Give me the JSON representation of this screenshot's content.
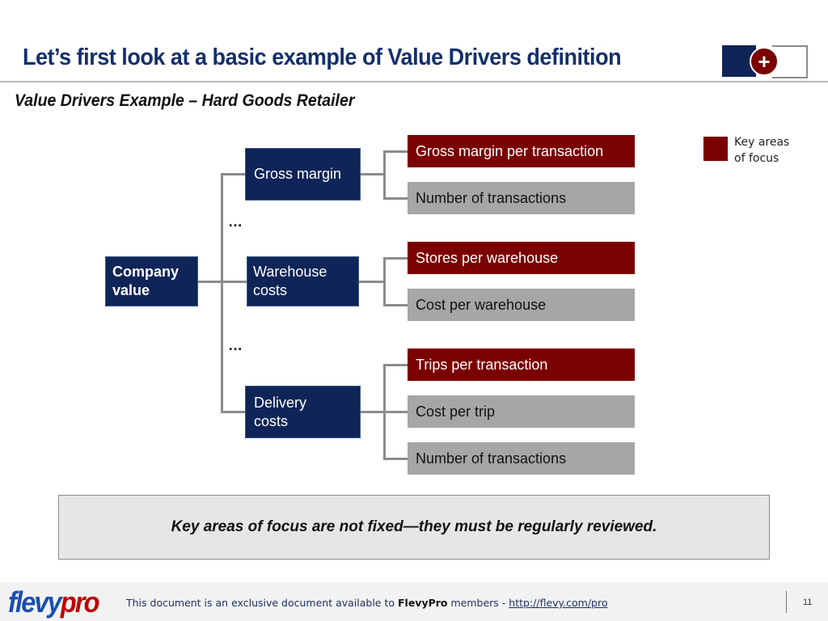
{
  "header": {
    "title": "Let’s first look at a basic example of Value Drivers definition",
    "subtitle": "Value Drivers Example – Hard Goods Retailer",
    "logo_icon": "plus-icon",
    "logo_symbol": "+"
  },
  "legend": {
    "label_line1": "Key areas",
    "label_line2": "of focus",
    "color": "#7b0000"
  },
  "colors": {
    "level1": "#0f2557",
    "key_focus": "#7b0000",
    "other": "#a6a6a6"
  },
  "tree": {
    "root": {
      "line1": "Company",
      "line2": "value"
    },
    "ellipsis": "…",
    "drivers": [
      {
        "line1": "Gross margin",
        "line2": "",
        "children": [
          {
            "label": "Gross margin per transaction",
            "key_focus": true
          },
          {
            "label": "Number of transactions",
            "key_focus": false
          }
        ]
      },
      {
        "line1": "Warehouse",
        "line2": "costs",
        "children": [
          {
            "label": "Stores per warehouse",
            "key_focus": true
          },
          {
            "label": "Cost per warehouse",
            "key_focus": false
          }
        ]
      },
      {
        "line1": "Delivery",
        "line2": "costs",
        "children": [
          {
            "label": "Trips per transaction",
            "key_focus": true
          },
          {
            "label": "Cost per trip",
            "key_focus": false
          },
          {
            "label": "Number of transactions",
            "key_focus": false
          }
        ]
      }
    ]
  },
  "note": "Key areas of focus are not fixed—they must be regularly reviewed.",
  "footer": {
    "brand_part1": "flevy",
    "brand_part2": "pro",
    "text_before": "This document is an exclusive document available to ",
    "brand_name": "FlevyPro",
    "text_after": " members - ",
    "link": "http://flevy.com/pro",
    "page_number": "11"
  }
}
